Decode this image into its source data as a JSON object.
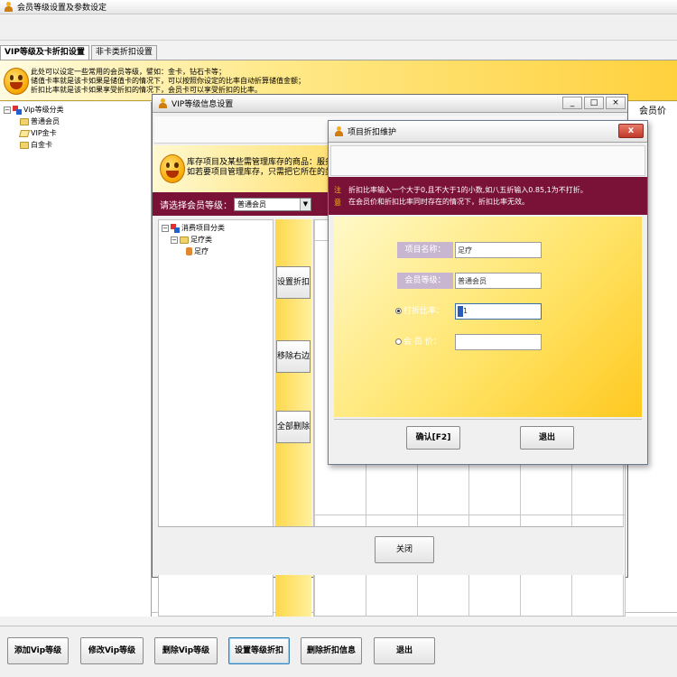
{
  "main": {
    "title": "会员等级设置及参数设定",
    "tabs": [
      "VIP等级及卡折扣设置",
      "非卡类折扣设置"
    ],
    "banner_lines": [
      "此处可以设定一些常用的会员等级，譬如：金卡，钻石卡等；",
      "储值卡率就是该卡如果是储值卡的情况下，可以按照你设定的比率自动折算储值金额；",
      "折扣比率就是该卡如果享受折扣的情况下，会员卡可以享受折扣的比率。"
    ],
    "tree": {
      "root": "Vip等级分类",
      "children": [
        "普通会员",
        "VIP金卡",
        "白金卡"
      ]
    },
    "right_header_peek": "会员价",
    "bottom_buttons": [
      "添加Vip等级",
      "修改Vip等级",
      "删除Vip等级",
      "设置等级折扣",
      "删除折扣信息",
      "退出"
    ]
  },
  "vip_window": {
    "title": "VIP等级信息设置",
    "controls": [
      "_",
      "□",
      "×"
    ],
    "banner_lines": [
      "库存项目及某些需管理库存的商品：服务项",
      "如若要项目管理库存，只需把它所在的类型调整为"
    ],
    "level_label": "请选择会员等级：",
    "level_value": "普通会员",
    "tree": {
      "root": "消费项目分类",
      "child": "足疗类",
      "leaf": "足疗"
    },
    "side_buttons": [
      "设置折扣",
      "移除右边",
      "全部删除"
    ],
    "close_button": "关闭"
  },
  "dialog": {
    "title": "项目折扣维护",
    "close_glyph": "x",
    "note_marks": [
      "注",
      "意"
    ],
    "note_lines": [
      "折扣比率输入一个大于0,且不大于1的小数,如八五折输入0.85,1为不打折。",
      "在会员价和折扣比率同时存在的情况下，折扣比率无效。"
    ],
    "fields": {
      "item_name_label": "项目名称：",
      "item_name_value": "足疗",
      "level_label": "会员等级：",
      "level_value": "普通会员",
      "discount_label": "打折比率：",
      "discount_value": "1",
      "price_label": "会 员 价：",
      "price_value": ""
    },
    "confirm_button": "确认[F2]",
    "exit_button": "退出"
  },
  "colors": {
    "maroon": "#7a1238",
    "yellow": "#ffd84a",
    "label_purple": "#c8b6d0"
  }
}
